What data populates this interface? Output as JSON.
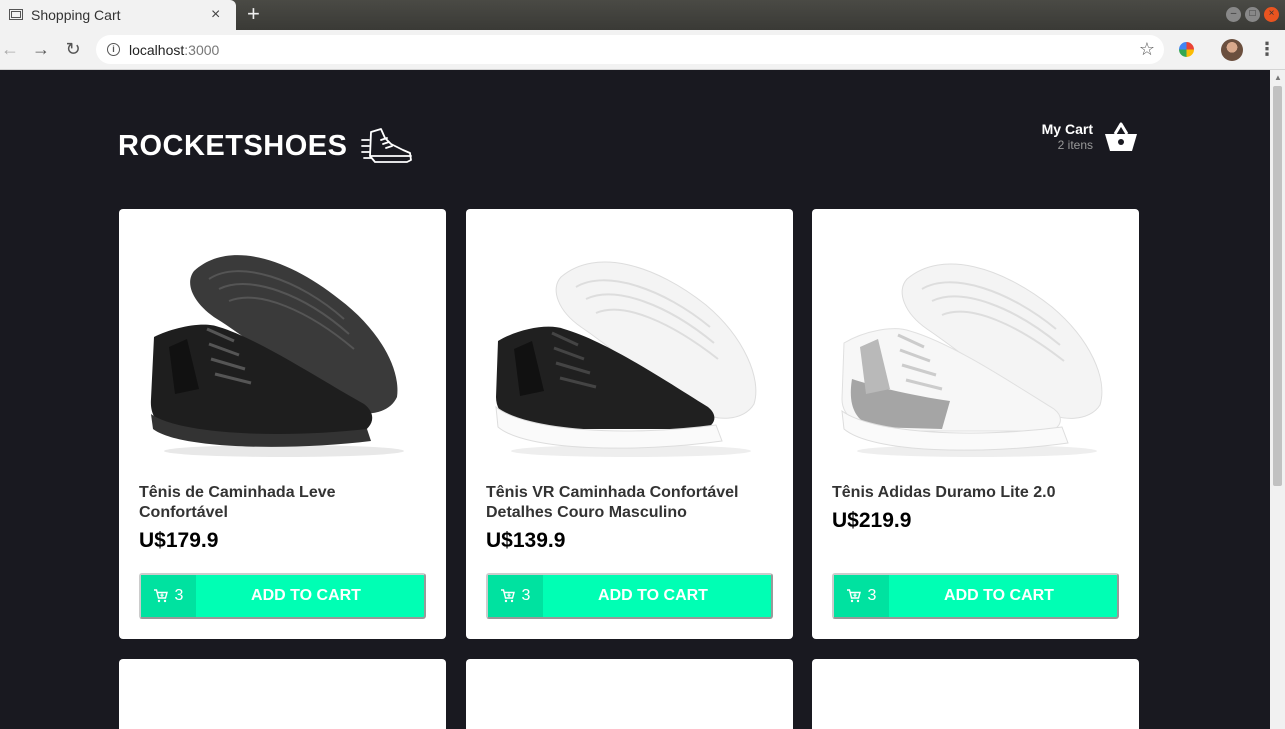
{
  "browser": {
    "tab_title": "Shopping Cart",
    "tab_close": "×",
    "new_tab": "+",
    "url_host": "localhost",
    "url_port": ":3000"
  },
  "header": {
    "logo": "ROCKETSHOES",
    "cart_title": "My Cart",
    "cart_count": "2 itens"
  },
  "products": [
    {
      "title": "Tênis de Caminhada Leve Confortável",
      "price": "U$179.9",
      "qty": "3",
      "button": "ADD TO CART",
      "style": "black"
    },
    {
      "title": "Tênis VR Caminhada Confortável Detalhes Couro Masculino",
      "price": "U$139.9",
      "qty": "3",
      "button": "ADD TO CART",
      "style": "black-white"
    },
    {
      "title": "Tênis Adidas Duramo Lite 2.0",
      "price": "U$219.9",
      "qty": "3",
      "button": "ADD TO CART",
      "style": "white-grey"
    }
  ],
  "colors": {
    "page_bg": "#191920",
    "accent": "#00ffb4",
    "accent_dark": "#00e2a0"
  }
}
